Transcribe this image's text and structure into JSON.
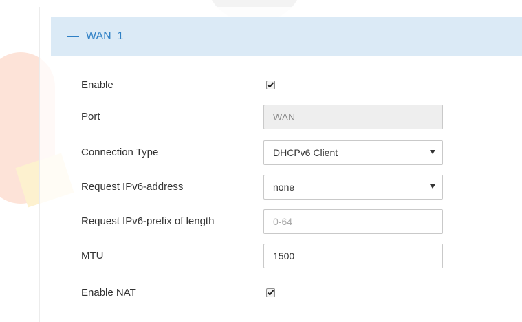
{
  "section": {
    "title": "WAN_1",
    "collapse_icon": "minus-icon"
  },
  "fields": {
    "enable": {
      "label": "Enable",
      "checked": true
    },
    "port": {
      "label": "Port",
      "value": "WAN"
    },
    "connection_type": {
      "label": "Connection Type",
      "value": "DHCPv6 Client"
    },
    "request_ipv6_address": {
      "label": "Request IPv6-address",
      "value": "none"
    },
    "request_ipv6_prefix": {
      "label": "Request IPv6-prefix of length",
      "value": "",
      "placeholder": "0-64"
    },
    "mtu": {
      "label": "MTU",
      "value": "1500"
    },
    "enable_nat": {
      "label": "Enable NAT",
      "checked": true
    }
  },
  "colors": {
    "header_bg": "#dbeaf6",
    "accent": "#2f80c5"
  }
}
